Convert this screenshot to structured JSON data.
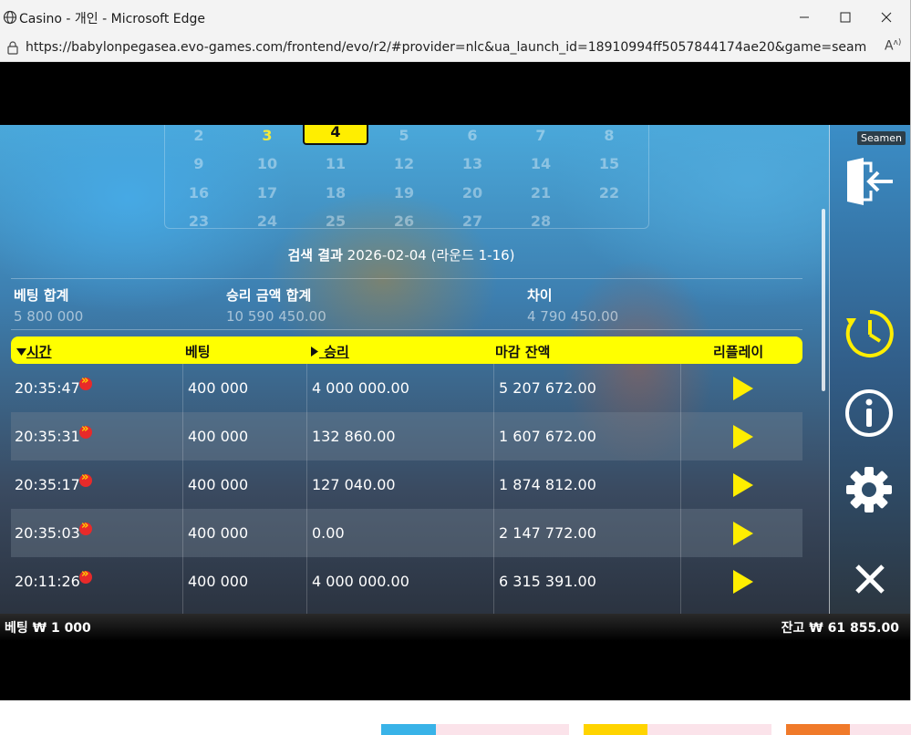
{
  "window": {
    "title": "Casino - 개인 - Microsoft Edge",
    "url": "https://babylonpegasea.evo-games.com/frontend/evo/r2/#provider=nlc&ua_launch_id=18910994ff5057844174ae20&game=seamen&table_id=sea..."
  },
  "calendar": {
    "days": [
      {
        "label": "2",
        "state": "dim"
      },
      {
        "label": "3",
        "state": "avail"
      },
      {
        "label": "4",
        "state": "selected"
      },
      {
        "label": "5",
        "state": "dim"
      },
      {
        "label": "6",
        "state": "dim"
      },
      {
        "label": "7",
        "state": "dim"
      },
      {
        "label": "8",
        "state": "dim"
      },
      {
        "label": "9",
        "state": "dim"
      },
      {
        "label": "10",
        "state": "dim"
      },
      {
        "label": "11",
        "state": "dim"
      },
      {
        "label": "12",
        "state": "dim"
      },
      {
        "label": "13",
        "state": "dim"
      },
      {
        "label": "14",
        "state": "dim"
      },
      {
        "label": "15",
        "state": "dim"
      },
      {
        "label": "16",
        "state": "dim"
      },
      {
        "label": "17",
        "state": "dim"
      },
      {
        "label": "18",
        "state": "dim"
      },
      {
        "label": "19",
        "state": "dim"
      },
      {
        "label": "20",
        "state": "dim"
      },
      {
        "label": "21",
        "state": "dim"
      },
      {
        "label": "22",
        "state": "dim"
      },
      {
        "label": "23",
        "state": "dim"
      },
      {
        "label": "24",
        "state": "dim"
      },
      {
        "label": "25",
        "state": "dim"
      },
      {
        "label": "26",
        "state": "dim"
      },
      {
        "label": "27",
        "state": "dim"
      },
      {
        "label": "28",
        "state": "dim"
      }
    ]
  },
  "search": {
    "label": "검색 결과",
    "value": "2026-02-04 (라운드 1-16)"
  },
  "summary": {
    "bet_total_label": "베팅 합계",
    "bet_total_value": "5 800 000",
    "win_total_label": "승리 금액 합계",
    "win_total_value": "10 590 450.00",
    "diff_label": "차이",
    "diff_value": "4 790 450.00"
  },
  "table": {
    "headers": {
      "time": "시간",
      "bet": "베팅",
      "win": "승리",
      "balance": "마감 잔액",
      "replay": "리플레이"
    },
    "rows": [
      {
        "time": "20:35:47",
        "bet": "400 000",
        "win": "4 000 000.00",
        "balance": "5 207 672.00"
      },
      {
        "time": "20:35:31",
        "bet": "400 000",
        "win": "132 860.00",
        "balance": "1 607 672.00"
      },
      {
        "time": "20:35:17",
        "bet": "400 000",
        "win": "127 040.00",
        "balance": "1 874 812.00"
      },
      {
        "time": "20:35:03",
        "bet": "400 000",
        "win": "0.00",
        "balance": "2 147 772.00"
      },
      {
        "time": "20:11:26",
        "bet": "400 000",
        "win": "4 000 000.00",
        "balance": "6 315 391.00"
      }
    ]
  },
  "sidebar": {
    "game_tag": "Seamen",
    "icons": [
      "exit-icon",
      "history-icon",
      "info-icon",
      "settings-icon",
      "close-icon"
    ]
  },
  "status": {
    "bet": "베팅  ₩ 1 000",
    "balance": "잔고  ₩ 61 855.00"
  },
  "colors": {
    "accent": "#ffee00",
    "header_bg": "#ffff00"
  }
}
